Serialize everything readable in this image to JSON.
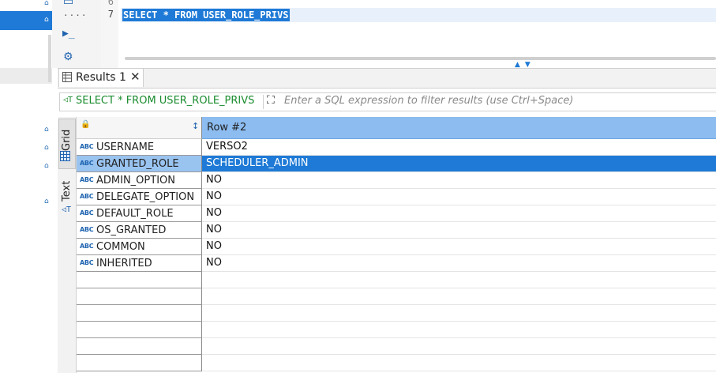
{
  "editor": {
    "line_numbers": [
      "6",
      "7"
    ],
    "sql": "SELECT * FROM USER_ROLE_PRIVS",
    "left_ellipsis": "...."
  },
  "results": {
    "tab_label": "Results 1",
    "filter_query": "SELECT * FROM USER_ROLE_PRIVS",
    "filter_placeholder": "Enter a SQL expression to filter results (use Ctrl+Space)",
    "side_tabs": [
      "Grid",
      "Text"
    ],
    "column_header": "Row #2",
    "type_badge": "ABC",
    "rows": [
      {
        "name": "USERNAME",
        "value": "VERSO2"
      },
      {
        "name": "GRANTED_ROLE",
        "value": "SCHEDULER_ADMIN"
      },
      {
        "name": "ADMIN_OPTION",
        "value": "NO"
      },
      {
        "name": "DELEGATE_OPTION",
        "value": "NO"
      },
      {
        "name": "DEFAULT_ROLE",
        "value": "NO"
      },
      {
        "name": "OS_GRANTED",
        "value": "NO"
      },
      {
        "name": "COMMON",
        "value": "NO"
      },
      {
        "name": "INHERITED",
        "value": "NO"
      }
    ],
    "selected_row": "GRANTED_ROLE"
  },
  "icons": [
    "db-icon",
    "terminal-icon",
    "gear-icon",
    "lock-icon",
    "sort-icon",
    "grid-icon",
    "text-icon",
    "filter-icon",
    "expand-icon",
    "close-icon"
  ],
  "colors": {
    "selection": "#1e7ad6",
    "header": "#8cbcf0",
    "filter_text": "#1a8c2e"
  }
}
